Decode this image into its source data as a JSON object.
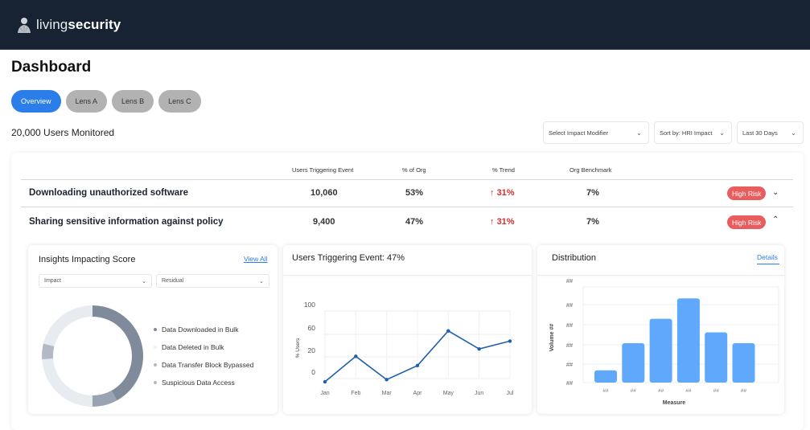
{
  "app": {
    "brand_light": "living",
    "brand_bold": "security"
  },
  "page": {
    "title": "Dashboard",
    "users_monitored": "20,000 Users Monitored"
  },
  "tabs": [
    {
      "label": "Overview",
      "active": true
    },
    {
      "label": "Lens A",
      "active": false
    },
    {
      "label": "Lens B",
      "active": false
    },
    {
      "label": "Lens C",
      "active": false
    }
  ],
  "filters": [
    {
      "value": "Select Impact Modifier"
    },
    {
      "value": "Sort by: HRI Impact"
    },
    {
      "value": "Last 30 Days"
    }
  ],
  "table": {
    "headers": [
      "Users Triggering Event",
      "% of Org",
      "% Trend",
      "Org Benchmark"
    ],
    "rows": [
      {
        "name": "Downloading unauthorized software",
        "users": "10,060",
        "pct_org": "53%",
        "trend": "31%",
        "trend_arrow": "↑",
        "benchmark": "7%",
        "risk": "High Risk",
        "expanded": false
      },
      {
        "name": "Sharing sensitive information against policy",
        "users": "9,400",
        "pct_org": "47%",
        "trend": "31%",
        "trend_arrow": "↑",
        "benchmark": "7%",
        "risk": "High Risk",
        "expanded": true
      }
    ]
  },
  "colors": {
    "accent": "#2b7de9",
    "risk": "#e85d5d",
    "trend_up": "#d32f2f",
    "header_bg": "#172232",
    "line": "#1f5fae",
    "bar": "#60a8fb"
  },
  "insights": {
    "title": "Insights Impacting Score",
    "view_all": "View All",
    "select1": "Impact",
    "select2": "Residual"
  },
  "line_panel": {
    "title": "Users Triggering Event: 47%"
  },
  "distribution": {
    "title": "Distribution",
    "details": "Details"
  },
  "chart_data": [
    {
      "type": "pie",
      "title": "Insights Impacting Score",
      "donut": true,
      "segments": [
        {
          "label": "Data Downloaded in Bulk",
          "value": 42,
          "color": "#7f8a9b"
        },
        {
          "label": "Data Transfer Block Bypassed",
          "value": 8,
          "color": "#9aa3b2"
        },
        {
          "label": "Data Deleted in Bulk",
          "value": 24,
          "color": "#e8ebf0"
        },
        {
          "label": "Suspicious Data Access",
          "value": 5,
          "color": "#b3bac6"
        },
        {
          "label": "Data Deleted in Bulk",
          "value": 21,
          "color": "#e8ebf0"
        }
      ],
      "legend": [
        {
          "label": "Data Downloaded in Bulk",
          "color": "#7f8a9b"
        },
        {
          "label": "Data Deleted in Bulk",
          "color": "#eef0f3"
        },
        {
          "label": "Data Transfer Block Bypassed",
          "color": "#b3bac6"
        },
        {
          "label": "Suspicious Data Access",
          "color": "#b3bac6"
        }
      ],
      "legend_position": "right"
    },
    {
      "type": "line",
      "title": "Users Triggering Event: 47%",
      "x": [
        "Jan",
        "Feb",
        "Mar",
        "Apr",
        "May",
        "Jun",
        "Jul"
      ],
      "series": [
        {
          "name": "% Users",
          "values": [
            -3,
            21,
            -1,
            12,
            66,
            34,
            48
          ]
        }
      ],
      "ylabel": "% Users",
      "xlabel": "",
      "yticks": [
        "100",
        "60",
        "20",
        "0"
      ],
      "ylim": [
        -10,
        100
      ],
      "grid": true
    },
    {
      "type": "bar",
      "title": "Distribution",
      "categories": [
        "##",
        "##",
        "##",
        "##",
        "##",
        "##"
      ],
      "values": [
        9,
        29,
        47,
        62,
        37,
        29
      ],
      "yticks": [
        "##",
        "##",
        "##",
        "##",
        "##",
        "##"
      ],
      "xlabel": "Measure",
      "ylabel": "Volume ##",
      "ylim": [
        0,
        100
      ],
      "grid": true
    }
  ]
}
